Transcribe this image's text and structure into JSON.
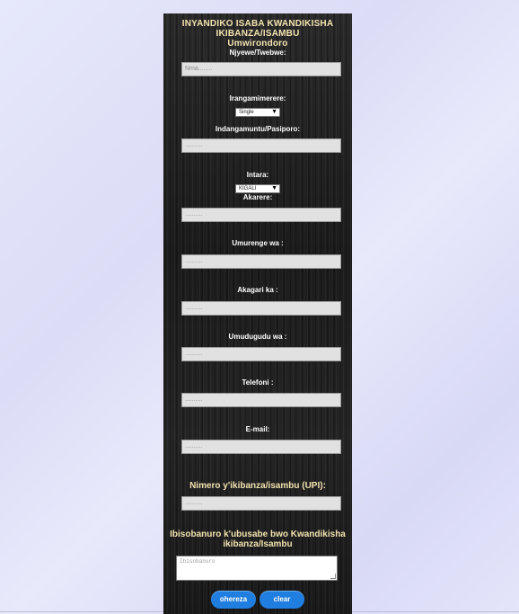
{
  "header": {
    "title_line1": "INYANDIKO ISABA KWANDIKISHA",
    "title_line2": "IKIBANZA/ISAMBU",
    "subtitle": "Umwirondoro"
  },
  "form": {
    "names": {
      "label": "Njyewe/Twebwe:",
      "placeholder": "Nma........"
    },
    "marital_status": {
      "label": "Irangamimerere:",
      "selected": "Single"
    },
    "id_passport": {
      "label": "Indangamuntu/Pasiporo:",
      "placeholder": ".........."
    },
    "province": {
      "label": "Intara:",
      "selected": "KIGALI"
    },
    "district": {
      "label": "Akarere:",
      "placeholder": ".........."
    },
    "sector": {
      "label": "Umurenge wa :",
      "placeholder": ".........."
    },
    "cell": {
      "label": "Akagari ka :",
      "placeholder": ".........."
    },
    "village": {
      "label": "Umudugudu wa :",
      "placeholder": ".........."
    },
    "phone": {
      "label": "Telefoni :",
      "placeholder": ".........."
    },
    "email": {
      "label": "E-mail:",
      "placeholder": ".........."
    },
    "upi": {
      "label": "Nimero y'ikibanza/isambu (UPI):",
      "placeholder": ".........."
    },
    "notes": {
      "label_line1": "Ibisobanuro k'ubusabe bwo Kwandikisha",
      "label_line2": "ikibanza/Isambu",
      "placeholder": "Ibisobanuro"
    }
  },
  "buttons": {
    "submit": "ohereza",
    "clear": "clear"
  },
  "icons": {
    "dropdown": "dropdown-arrow-icon"
  },
  "colors": {
    "title": "#f3e3b0",
    "button": "#1f7ee0",
    "panel": "#1f1f1f"
  }
}
